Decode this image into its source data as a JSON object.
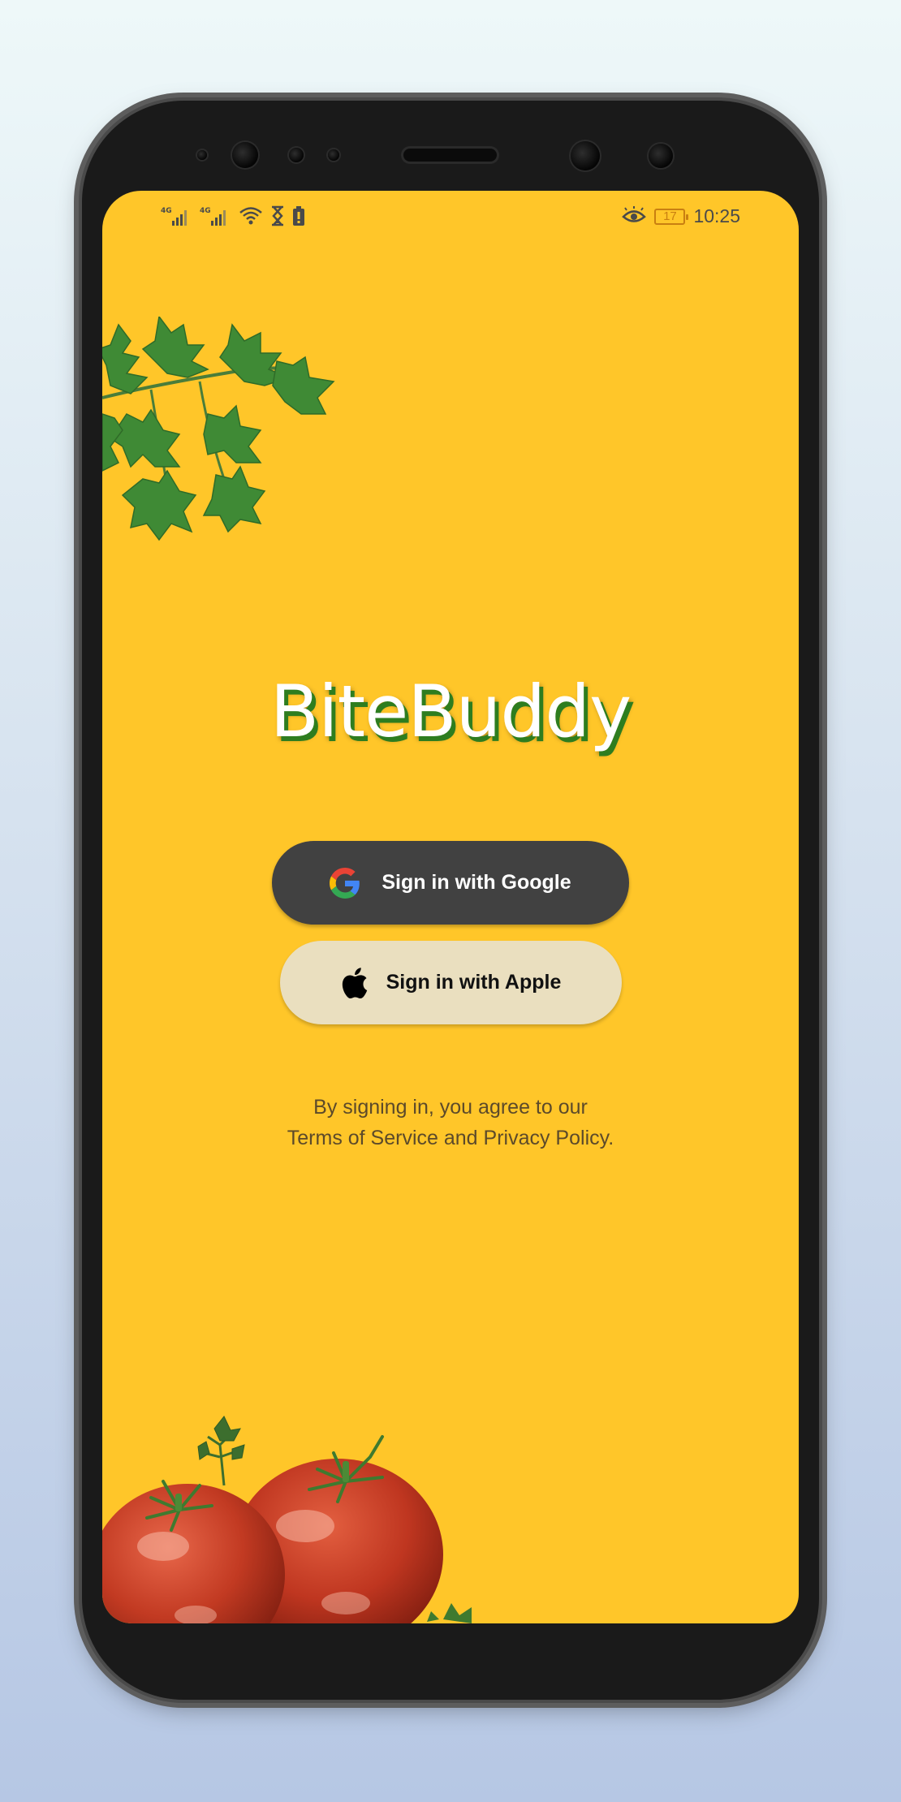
{
  "status_bar": {
    "left_icons": [
      "signal-4g-icon",
      "signal-4g-icon",
      "wifi-icon",
      "hourglass-icon",
      "battery-saver-icon"
    ],
    "signal1_label": "4G",
    "signal2_label": "4G",
    "eye_icon": "eye-comfort-icon",
    "battery_level": "17",
    "time": "10:25"
  },
  "app": {
    "title": "BiteBuddy"
  },
  "auth": {
    "google_label": "Sign in with Google",
    "google_icon": "google-logo-icon",
    "apple_label": "Sign in with Apple",
    "apple_icon": "apple-logo-icon"
  },
  "terms": {
    "line1": "By signing in, you agree to our",
    "line2": "Terms of Service and Privacy Policy."
  },
  "colors": {
    "background": "#ffc629",
    "google_button": "#414141",
    "apple_button": "#eadfbf",
    "title_shadow": "#2e7d1f"
  }
}
